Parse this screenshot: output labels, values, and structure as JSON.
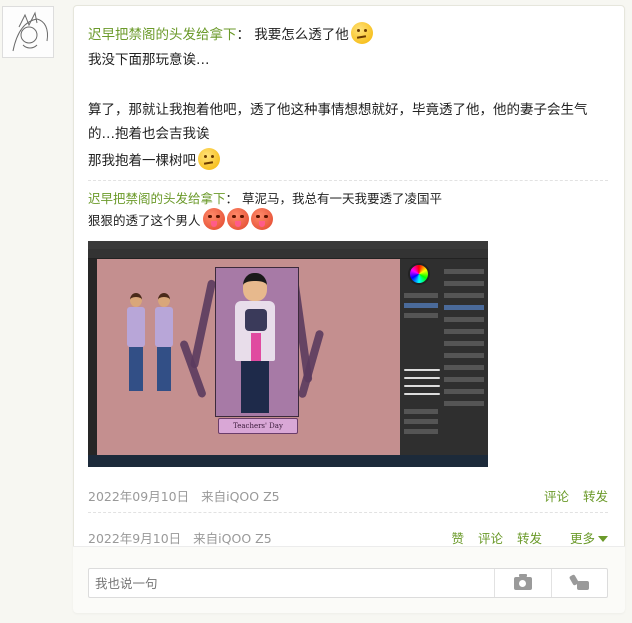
{
  "user": {
    "name": "迟早把禁阁的头发给拿下"
  },
  "post": {
    "line1": "我要怎么透了他",
    "line2": "我没下面那玩意诶…",
    "line3": "算了，那就让我抱着他吧，透了他这种事情想想就好，毕竟透了他，他的妻子会生气的…抱着也会吉我诶",
    "line4": "那我抱着一棵树吧",
    "emojis": [
      "thinking-face-icon",
      "hot-face-icon"
    ]
  },
  "repost": {
    "author": "迟早把禁阁的头发给拿下",
    "text": "草泥马，我总有一天我要透了凌国平",
    "text2": "狠狠的透了这个男人"
  },
  "image": {
    "banner": "Teachers' Day"
  },
  "meta1": {
    "date": "2022年09月10日",
    "source": "来自iQOO Z5",
    "comment": "评论",
    "repost": "转发"
  },
  "meta2": {
    "date": "2022年9月10日",
    "source": "来自iQOO Z5",
    "like": "赞",
    "comment": "评论",
    "repost": "转发",
    "more": "更多"
  },
  "comment_box": {
    "placeholder": "我也说一句"
  },
  "colors": {
    "accent": "#6b9a2a",
    "canvas": "#c48f8f"
  }
}
